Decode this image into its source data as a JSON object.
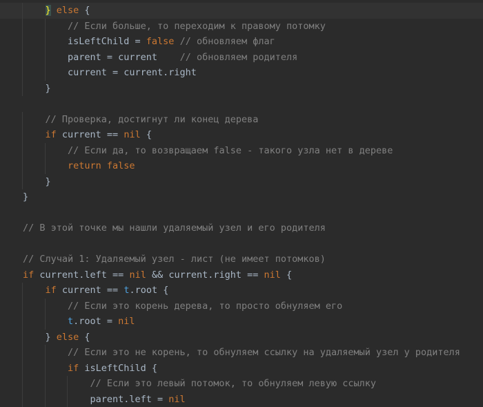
{
  "editor": {
    "current_line": 0,
    "lines": [
      {
        "indent": 2,
        "tokens": [
          [
            "br",
            "}"
          ],
          [
            "tx",
            " "
          ],
          [
            "kw",
            "else"
          ],
          [
            "tx",
            " {"
          ]
        ]
      },
      {
        "indent": 3,
        "tokens": [
          [
            "cm",
            "// Если больше, то переходим к правому потомку"
          ]
        ]
      },
      {
        "indent": 3,
        "tokens": [
          [
            "tx",
            "isLeftChild = "
          ],
          [
            "kw",
            "false"
          ],
          [
            "cm",
            " // обновляем флаг"
          ]
        ]
      },
      {
        "indent": 3,
        "tokens": [
          [
            "tx",
            "parent = current    "
          ],
          [
            "cm",
            "// обновляем родителя"
          ]
        ]
      },
      {
        "indent": 3,
        "tokens": [
          [
            "tx",
            "current = current.right"
          ]
        ]
      },
      {
        "indent": 2,
        "tokens": [
          [
            "tx",
            "}"
          ]
        ]
      },
      {
        "indent": 0,
        "tokens": []
      },
      {
        "indent": 2,
        "tokens": [
          [
            "cm",
            "// Проверка, достигнут ли конец дерева"
          ]
        ]
      },
      {
        "indent": 2,
        "tokens": [
          [
            "kw",
            "if"
          ],
          [
            "tx",
            " current == "
          ],
          [
            "kw",
            "nil"
          ],
          [
            "tx",
            " {"
          ]
        ]
      },
      {
        "indent": 3,
        "tokens": [
          [
            "cm",
            "// Если да, то возвращаем false - такого узла нет в дереве"
          ]
        ]
      },
      {
        "indent": 3,
        "tokens": [
          [
            "kw",
            "return false"
          ]
        ]
      },
      {
        "indent": 2,
        "tokens": [
          [
            "tx",
            "}"
          ]
        ]
      },
      {
        "indent": 1,
        "tokens": [
          [
            "tx",
            "}"
          ]
        ]
      },
      {
        "indent": 0,
        "tokens": []
      },
      {
        "indent": 1,
        "tokens": [
          [
            "cm",
            "// В этой точке мы нашли удаляемый узел и его родителя"
          ]
        ]
      },
      {
        "indent": 0,
        "tokens": []
      },
      {
        "indent": 1,
        "tokens": [
          [
            "cm",
            "// Случай 1: Удаляемый узел - лист (не имеет потомков)"
          ]
        ]
      },
      {
        "indent": 1,
        "tokens": [
          [
            "kw",
            "if"
          ],
          [
            "tx",
            " current.left == "
          ],
          [
            "kw",
            "nil"
          ],
          [
            "tx",
            " && current.right == "
          ],
          [
            "kw",
            "nil"
          ],
          [
            "tx",
            " {"
          ]
        ]
      },
      {
        "indent": 2,
        "tokens": [
          [
            "kw",
            "if"
          ],
          [
            "tx",
            " current == "
          ],
          [
            "pa",
            "t"
          ],
          [
            "tx",
            ".root {"
          ]
        ]
      },
      {
        "indent": 3,
        "tokens": [
          [
            "cm",
            "// Если это корень дерева, то просто обнуляем его"
          ]
        ]
      },
      {
        "indent": 3,
        "tokens": [
          [
            "pa",
            "t"
          ],
          [
            "tx",
            ".root = "
          ],
          [
            "kw",
            "nil"
          ]
        ]
      },
      {
        "indent": 2,
        "tokens": [
          [
            "tx",
            "} "
          ],
          [
            "kw",
            "else"
          ],
          [
            "tx",
            " {"
          ]
        ]
      },
      {
        "indent": 3,
        "tokens": [
          [
            "cm",
            "// Если это не корень, то обнуляем ссылку на удаляемый узел у родителя"
          ]
        ]
      },
      {
        "indent": 3,
        "tokens": [
          [
            "kw",
            "if"
          ],
          [
            "tx",
            " isLeftChild {"
          ]
        ]
      },
      {
        "indent": 4,
        "tokens": [
          [
            "cm",
            "// Если это левый потомок, то обнуляем левую ссылку"
          ]
        ]
      },
      {
        "indent": 4,
        "tokens": [
          [
            "tx",
            "parent.left = "
          ],
          [
            "kw",
            "nil"
          ]
        ]
      }
    ]
  }
}
